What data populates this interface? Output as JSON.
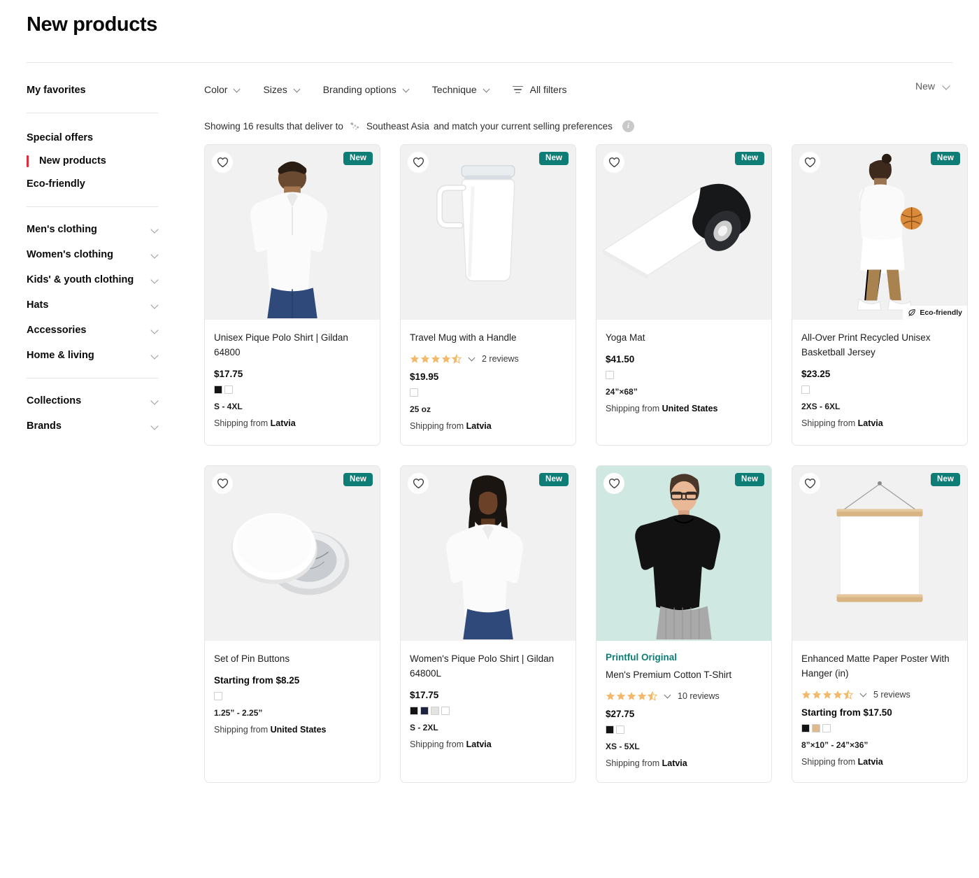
{
  "header": {
    "title": "New products"
  },
  "sidebar": {
    "favorites_label": "My favorites",
    "promo_items": [
      {
        "label": "Special offers",
        "active": false
      },
      {
        "label": "New products",
        "active": true
      },
      {
        "label": "Eco-friendly",
        "active": false
      }
    ],
    "categories": [
      {
        "label": "Men's clothing"
      },
      {
        "label": "Women's clothing"
      },
      {
        "label": "Kids' & youth clothing"
      },
      {
        "label": "Hats"
      },
      {
        "label": "Accessories"
      },
      {
        "label": "Home & living"
      }
    ],
    "groups": [
      {
        "label": "Collections"
      },
      {
        "label": "Brands"
      }
    ]
  },
  "filters": {
    "items": [
      {
        "label": "Color"
      },
      {
        "label": "Sizes"
      },
      {
        "label": "Branding options"
      },
      {
        "label": "Technique"
      }
    ],
    "all_filters_label": "All filters",
    "sort_value": "New"
  },
  "results": {
    "prefix": "Showing 16 results that deliver to",
    "region": "Southeast Asia",
    "suffix": "and match your current selling preferences",
    "count": 16,
    "info_glyph": "i"
  },
  "badges": {
    "new_label": "New",
    "eco_label": "Eco-friendly",
    "new_color": "#0d7d75",
    "brand_color": "#0d7d75",
    "accent_red": "#e12d39"
  },
  "products": [
    {
      "title": "Unisex Pique Polo Shirt | Gildan 64800",
      "brand_tag": "",
      "price": "$17.75",
      "rating": null,
      "reviews_label": "",
      "swatches": [
        "#141414",
        "#ffffff"
      ],
      "size_range": "S - 4XL",
      "ship_prefix": "Shipping from",
      "ship_country": "Latvia",
      "badge": "New",
      "eco": false,
      "bg": "#f1f1f1",
      "art": "polo-male"
    },
    {
      "title": "Travel Mug with a Handle",
      "brand_tag": "",
      "price": "$19.95",
      "rating": 4.5,
      "reviews_label": "2 reviews",
      "swatches": [
        "#ffffff"
      ],
      "size_range": "25 oz",
      "ship_prefix": "Shipping from",
      "ship_country": "Latvia",
      "badge": "New",
      "eco": false,
      "bg": "#f1f1f1",
      "art": "mug"
    },
    {
      "title": "Yoga Mat",
      "brand_tag": "",
      "price": "$41.50",
      "rating": null,
      "reviews_label": "",
      "swatches": [
        "#ffffff"
      ],
      "size_range": "24”×68”",
      "ship_prefix": "Shipping from",
      "ship_country": "United States",
      "badge": "New",
      "eco": false,
      "bg": "#f1f1f1",
      "art": "yogamat"
    },
    {
      "title": "All-Over Print Recycled Unisex Basketball Jersey",
      "brand_tag": "",
      "price": "$23.25",
      "rating": null,
      "reviews_label": "",
      "swatches": [
        "#ffffff"
      ],
      "size_range": "2XS - 6XL",
      "ship_prefix": "Shipping from",
      "ship_country": "Latvia",
      "badge": "New",
      "eco": true,
      "bg": "#f1f1f1",
      "art": "jersey"
    },
    {
      "title": "Set of Pin Buttons",
      "brand_tag": "",
      "price": "Starting from $8.25",
      "rating": null,
      "reviews_label": "",
      "swatches": [
        "#ffffff"
      ],
      "size_range": "1.25” - 2.25”",
      "ship_prefix": "Shipping from",
      "ship_country": "United States",
      "badge": "New",
      "eco": false,
      "bg": "#f1f1f1",
      "art": "pins"
    },
    {
      "title": "Women's Pique Polo Shirt | Gildan 64800L",
      "brand_tag": "",
      "price": "$17.75",
      "rating": null,
      "reviews_label": "",
      "swatches": [
        "#141414",
        "#1d2440",
        "#e2e2e2",
        "#ffffff"
      ],
      "size_range": "S - 2XL",
      "ship_prefix": "Shipping from",
      "ship_country": "Latvia",
      "badge": "New",
      "eco": false,
      "bg": "#f1f1f1",
      "art": "polo-female"
    },
    {
      "title": "Men's Premium Cotton T-Shirt",
      "brand_tag": "Printful Original",
      "price": "$27.75",
      "rating": 4.5,
      "reviews_label": "10 reviews",
      "swatches": [
        "#141414",
        "#ffffff"
      ],
      "size_range": "XS - 5XL",
      "ship_prefix": "Shipping from",
      "ship_country": "Latvia",
      "badge": "New",
      "eco": false,
      "bg": "#cfe9e2",
      "art": "tshirt"
    },
    {
      "title": "Enhanced Matte Paper Poster With Hanger (in)",
      "brand_tag": "",
      "price": "Starting from $17.50",
      "rating": 4.5,
      "reviews_label": "5 reviews",
      "swatches": [
        "#141414",
        "#e0b98d",
        "#ffffff"
      ],
      "size_range": "8”×10” - 24”×36”",
      "ship_prefix": "Shipping from",
      "ship_country": "Latvia",
      "badge": "New",
      "eco": false,
      "bg": "#f1f1f1",
      "art": "poster"
    }
  ]
}
